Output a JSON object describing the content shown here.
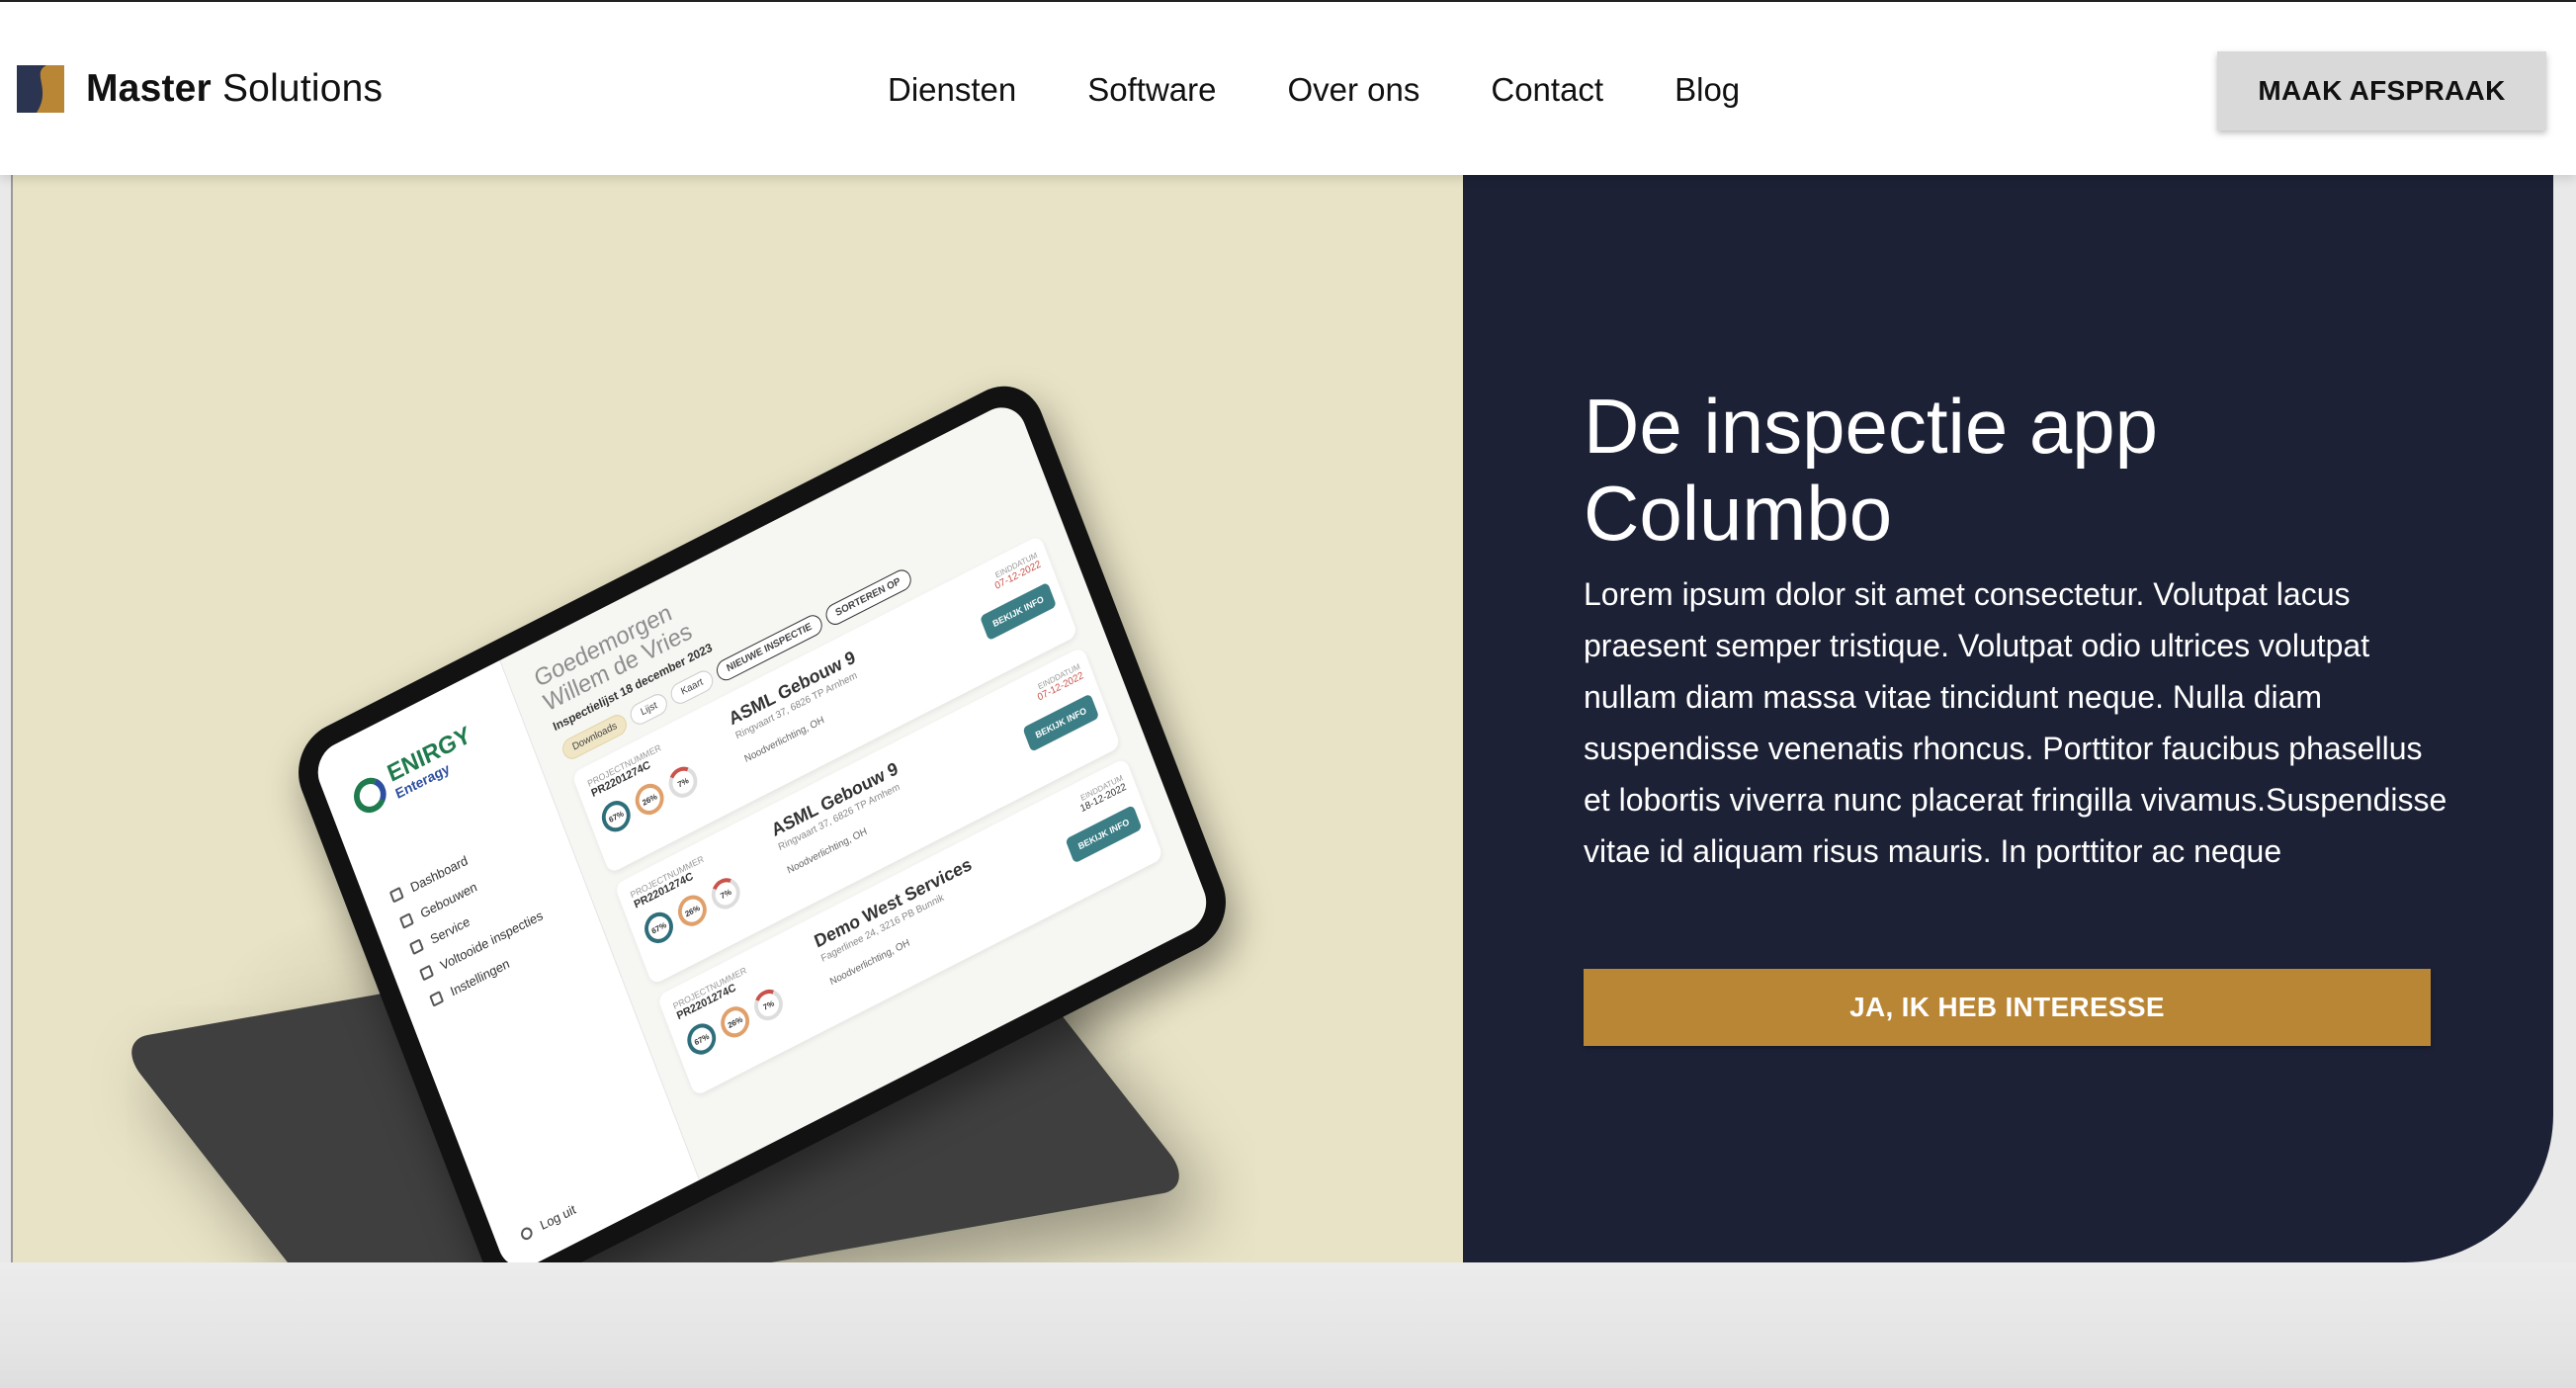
{
  "brand": {
    "name_bold": "Master",
    "name_rest": "Solutions",
    "mark_colors": [
      "#2b3552",
      "#b98635"
    ]
  },
  "nav": {
    "items": [
      {
        "label": "Diensten"
      },
      {
        "label": "Software"
      },
      {
        "label": "Over ons"
      },
      {
        "label": "Contact"
      },
      {
        "label": "Blog"
      }
    ],
    "cta_label": "MAAK AFSPRAAK"
  },
  "hero": {
    "title_line1": "De inspectie app",
    "title_line2": "Columbo",
    "body": "Lorem ipsum dolor sit amet consectetur. Volutpat lacus praesent semper tristique. Volutpat odio ultrices volutpat nullam diam massa vitae tincidunt neque. Nulla diam suspendisse venenatis rhoncus. Porttitor faucibus phasellus et lobortis viverra nunc placerat fringilla vivamus.Suspendisse vitae id aliquam risus mauris. In porttitor ac neque",
    "cta_label": "JA, IK HEB INTERESSE",
    "colors": {
      "panel": "#1c2136",
      "image_bg": "#e8e3c6",
      "accent": "#b98635"
    }
  },
  "mockup": {
    "brand_name": "ENIRGY",
    "brand_sub": "Enteragy",
    "menu": [
      "Dashboard",
      "Gebouwen",
      "Service",
      "Voltooide inspecties",
      "Instellingen"
    ],
    "logout": "Log uit",
    "heading_line1": "Goedemorgen",
    "heading_line2": "Willem de Vries",
    "subheading": "Inspectielijst 18 december 2023",
    "chips": [
      "Downloads",
      "Lijst",
      "Kaart",
      "NIEUWE INSPECTIE",
      "SORTEREN OP"
    ],
    "cards": [
      {
        "label": "PROJECTNUMMER",
        "number": "PR2201274C",
        "gauges": [
          "67%",
          "26%",
          "7%"
        ],
        "title": "ASML Gebouw 9",
        "address": "Ringvaart 37, 6826 TP Arnhem",
        "tag": "Noodverlichting, OH",
        "date_label": "EINDDATUM",
        "date": "07-12-2022",
        "button": "BEKIJK INFO"
      },
      {
        "label": "PROJECTNUMMER",
        "number": "PR2201274C",
        "gauges": [
          "67%",
          "26%",
          "7%"
        ],
        "title": "ASML Gebouw 9",
        "address": "Ringvaart 37, 6826 TP Arnhem",
        "tag": "Noodverlichting, OH",
        "date_label": "EINDDATUM",
        "date": "07-12-2022",
        "button": "BEKIJK INFO"
      },
      {
        "label": "PROJECTNUMMER",
        "number": "PR2201274C",
        "gauges": [
          "67%",
          "26%",
          "7%"
        ],
        "title": "Demo West Services",
        "address": "Fagerlinee 24, 3216 PB Bunnik",
        "tag": "Noodverlichting, OH",
        "date_label": "EINDDATUM",
        "date": "18-12-2022",
        "button": "BEKIJK INFO"
      }
    ]
  }
}
